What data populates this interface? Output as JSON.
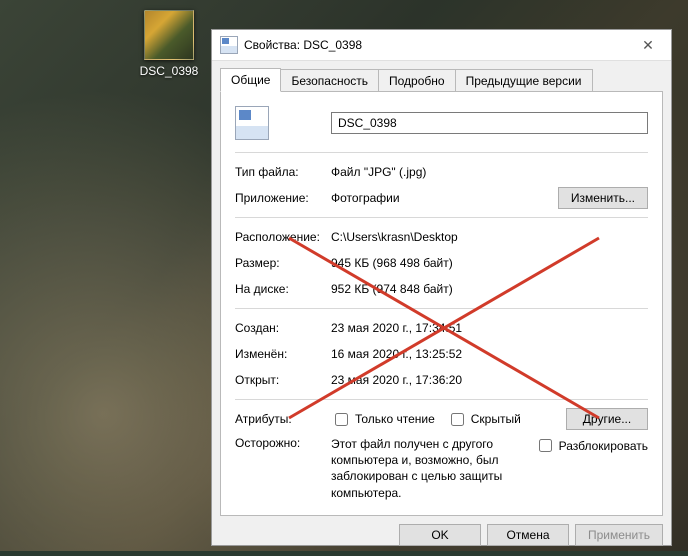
{
  "desktop": {
    "icon_label": "DSC_0398"
  },
  "window": {
    "title": "Свойства: DSC_0398",
    "close_glyph": "✕"
  },
  "tabs": {
    "general": "Общие",
    "security": "Безопасность",
    "details": "Подробно",
    "previous": "Предыдущие версии"
  },
  "general": {
    "filename": "DSC_0398",
    "row_type_label": "Тип файла:",
    "row_type_value": "Файл \"JPG\" (.jpg)",
    "row_app_label": "Приложение:",
    "row_app_value": "Фотографии",
    "btn_change": "Изменить...",
    "row_location_label": "Расположение:",
    "row_location_value": "C:\\Users\\krasn\\Desktop",
    "row_size_label": "Размер:",
    "row_size_value": "945 КБ (968 498 байт)",
    "row_ondisk_label": "На диске:",
    "row_ondisk_value": "952 КБ (974 848 байт)",
    "row_created_label": "Создан:",
    "row_created_value": "23 мая 2020 г., 17:34:51",
    "row_modified_label": "Изменён:",
    "row_modified_value": "16 мая 2020 г., 13:25:52",
    "row_accessed_label": "Открыт:",
    "row_accessed_value": "23 мая 2020 г., 17:36:20",
    "row_attr_label": "Атрибуты:",
    "chk_readonly": "Только чтение",
    "chk_hidden": "Скрытый",
    "btn_other": "Другие...",
    "row_warn_label": "Осторожно:",
    "warn_text": "Этот файл получен с другого компьютера и, возможно, был заблокирован с целью защиты компьютера.",
    "chk_unblock": "Разблокировать"
  },
  "footer": {
    "ok": "OK",
    "cancel": "Отмена",
    "apply": "Применить"
  },
  "annotation": {
    "cross_color": "#d13b2a"
  }
}
